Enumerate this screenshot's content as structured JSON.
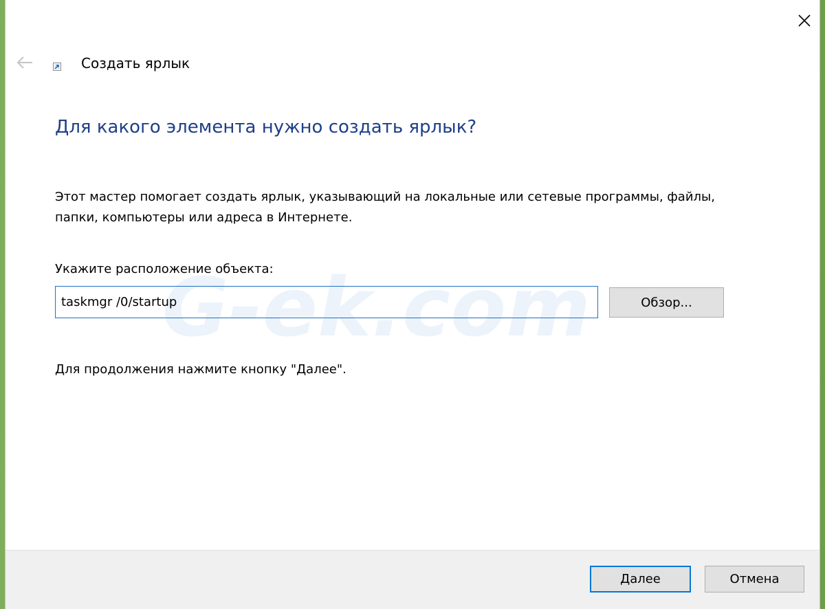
{
  "window": {
    "title": "Создать ярлык"
  },
  "wizard": {
    "heading": "Для какого элемента нужно создать ярлык?",
    "description": "Этот мастер помогает создать ярлык, указывающий на локальные или сетевые программы, файлы, папки, компьютеры или адреса в Интернете.",
    "location_label": "Укажите расположение объекта:",
    "location_value": "taskmgr /0/startup",
    "browse_label": "Обзор...",
    "hint": "Для продолжения нажмите кнопку \"Далее\"."
  },
  "footer": {
    "next_label": "Далее",
    "cancel_label": "Отмена"
  },
  "watermark": {
    "text": "G-ek.com"
  },
  "icons": {
    "close": "close-icon",
    "back": "back-arrow-icon",
    "title": "shortcut-icon"
  },
  "colors": {
    "heading": "#1e3f87",
    "input_border": "#1f6fc4",
    "default_button_border": "#0078d7",
    "footer_bg": "#f0f0f0"
  }
}
